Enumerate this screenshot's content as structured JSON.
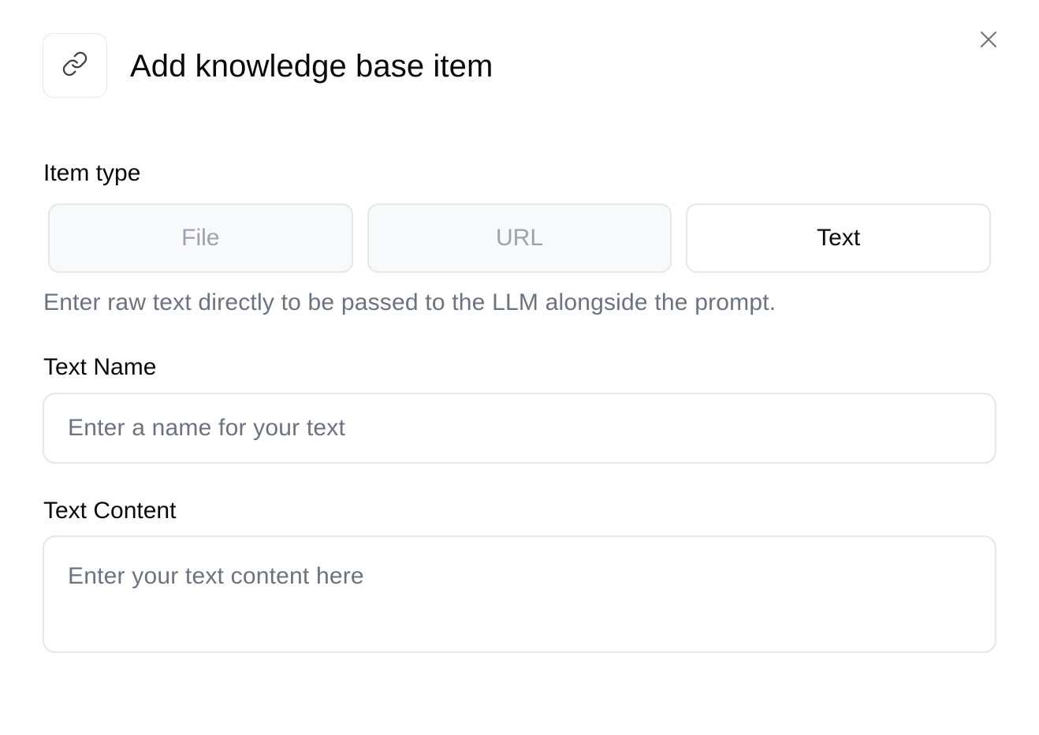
{
  "dialog": {
    "title": "Add knowledge base item",
    "header_icon": "link-icon",
    "close_icon": "close-icon"
  },
  "item_type": {
    "label": "Item type",
    "options": [
      {
        "label": "File",
        "selected": false
      },
      {
        "label": "URL",
        "selected": false
      },
      {
        "label": "Text",
        "selected": true
      }
    ],
    "help_text": "Enter raw text directly to be passed to the LLM alongside the prompt."
  },
  "text_name": {
    "label": "Text Name",
    "value": "",
    "placeholder": "Enter a name for your text"
  },
  "text_content": {
    "label": "Text Content",
    "value": "",
    "placeholder": "Enter your text content here"
  },
  "colors": {
    "border": "#e5e7eb",
    "muted_text": "#6b7280",
    "disabled_text": "#9ca3af",
    "inactive_tab_bg": "#f8f9fb"
  }
}
